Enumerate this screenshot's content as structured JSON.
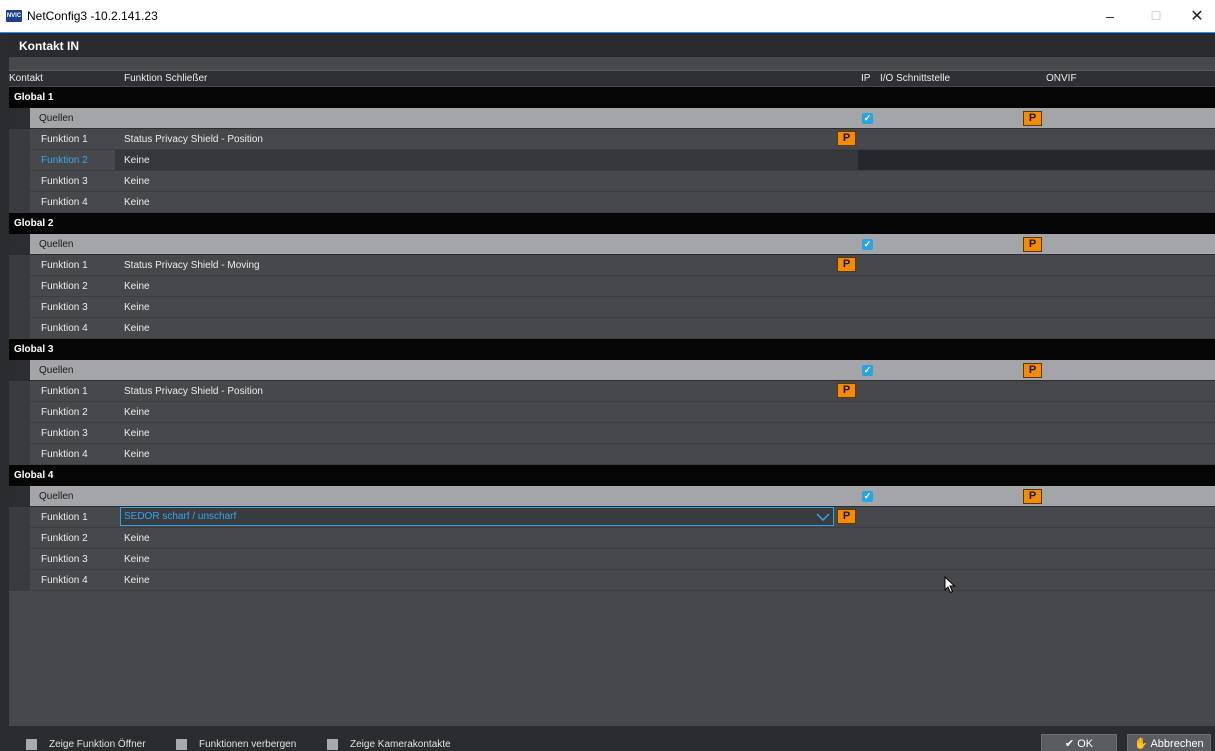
{
  "window": {
    "icon_text": "NVIC",
    "title": "NetConfig3 -10.2.141.23",
    "minimize": "–",
    "maximize": "☐",
    "close": "✕"
  },
  "header": {
    "title": "Kontakt IN"
  },
  "columns": {
    "kontakt": "Kontakt",
    "funktion": "Funktion Schließer",
    "ip": "IP",
    "io": "I/O Schnittstelle",
    "onvif": "ONVIF"
  },
  "groups": [
    {
      "name": "Global 1",
      "sources_label": "Quellen",
      "functions": [
        {
          "label": "Funktion 1",
          "value": "Status Privacy Shield - Position"
        },
        {
          "label": "Funktion 2",
          "value": "Keine"
        },
        {
          "label": "Funktion 3",
          "value": "Keine"
        },
        {
          "label": "Funktion 4",
          "value": "Keine"
        }
      ]
    },
    {
      "name": "Global 2",
      "sources_label": "Quellen",
      "functions": [
        {
          "label": "Funktion 1",
          "value": "Status Privacy Shield - Moving"
        },
        {
          "label": "Funktion 2",
          "value": "Keine"
        },
        {
          "label": "Funktion 3",
          "value": "Keine"
        },
        {
          "label": "Funktion 4",
          "value": "Keine"
        }
      ]
    },
    {
      "name": "Global 3",
      "sources_label": "Quellen",
      "functions": [
        {
          "label": "Funktion 1",
          "value": "Status Privacy Shield - Position"
        },
        {
          "label": "Funktion 2",
          "value": "Keine"
        },
        {
          "label": "Funktion 3",
          "value": "Keine"
        },
        {
          "label": "Funktion 4",
          "value": "Keine"
        }
      ]
    },
    {
      "name": "Global 4",
      "sources_label": "Quellen",
      "functions": [
        {
          "label": "Funktion 1",
          "value": "SEDOR scharf / unscharf"
        },
        {
          "label": "Funktion 2",
          "value": "Keine"
        },
        {
          "label": "Funktion 3",
          "value": "Keine"
        },
        {
          "label": "Funktion 4",
          "value": "Keine"
        }
      ]
    }
  ],
  "p_label": "P",
  "check_mark": "✓",
  "footer": {
    "show_opener": "Zeige Funktion Öffner",
    "hide_functions": "Funktionen verbergen",
    "show_camera_contacts": "Zeige Kamerakontakte",
    "ok_label": "OK",
    "ok_icon": "✔",
    "cancel_label": "Abbrechen",
    "cancel_icon": "✋"
  },
  "colors": {
    "accent": "#2ea3e6",
    "p_button": "#f58a07",
    "sources_row": "#a4a5a8",
    "background": "#47484c"
  }
}
